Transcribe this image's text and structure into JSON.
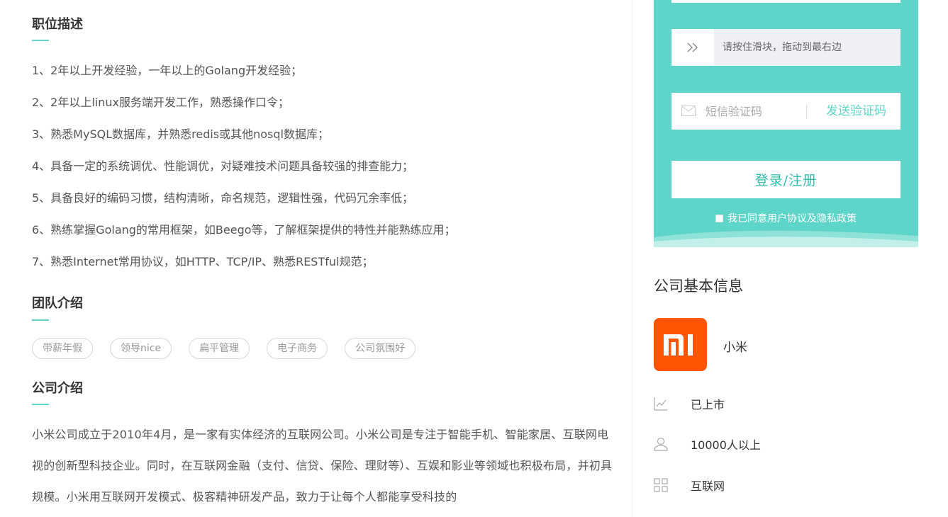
{
  "job_description": {
    "title": "职位描述",
    "requirements": [
      "1、2年以上开发经验，一年以上的Golang开发经验；",
      "2、2年以上linux服务端开发工作，熟悉操作口令；",
      "3、熟悉MySQL数据库，并熟悉redis或其他nosql数据库；",
      "4、具备一定的系统调优、性能调优，对疑难技术问题具备较强的排查能力；",
      "5、具备良好的编码习惯，结构清晰，命名规范，逻辑性强，代码冗余率低；",
      "6、熟练掌握Golang的常用框架，如Beego等，了解框架提供的特性并能熟练应用；",
      "7、熟悉Internet常用协议，如HTTP、TCP/IP、熟悉RESTful规范；"
    ]
  },
  "team": {
    "title": "团队介绍",
    "tags": [
      "带薪年假",
      "领导nice",
      "扁平管理",
      "电子商务",
      "公司氛围好"
    ]
  },
  "company_intro": {
    "title": "公司介绍",
    "text": "小米公司成立于2010年4月，是一家有实体经济的互联网公司。小米公司是专注于智能手机、智能家居、互联网电视的创新型科技企业。同时，在互联网金融（支付、信贷、保险、理财等）、互娱和影业等领域也积极布局，并初具规模。小米用互联网开发模式、极客精神研发产品，致力于让每个人都能享受科技的"
  },
  "login": {
    "slider_text": "请按住滑块，拖动到最右边",
    "sms_placeholder": "短信验证码",
    "send_code": "发送验证码",
    "submit": "登录/注册",
    "agree_text": "我已同意用户协议及隐私政策",
    "accent_color": "#5dd5c8"
  },
  "company_info": {
    "title": "公司基本信息",
    "name": "小米",
    "logo_color": "#ff5500",
    "stage": "已上市",
    "size": "10000人以上",
    "industry": "互联网"
  }
}
